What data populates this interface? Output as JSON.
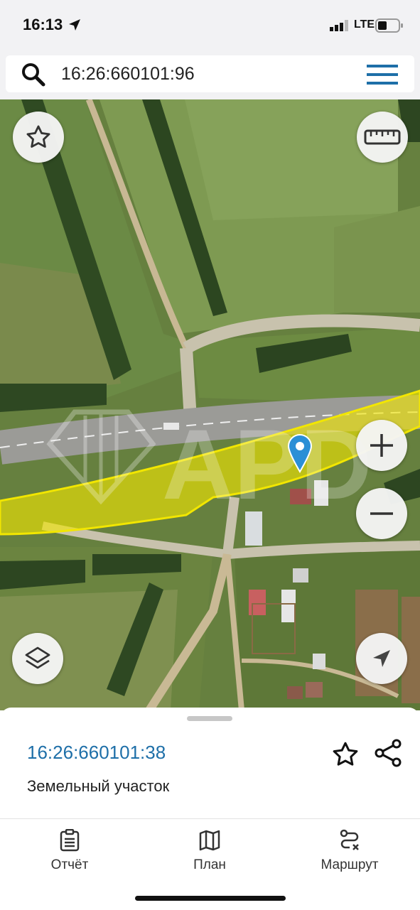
{
  "status_bar": {
    "time": "16:13",
    "network": "LTE"
  },
  "search": {
    "query": "16:26:660101:96"
  },
  "map": {
    "buttons": [
      "star-icon",
      "ruler-icon",
      "zoom-in-icon",
      "zoom-out-icon",
      "layers-icon",
      "location-arrow-icon"
    ],
    "watermark": "APD",
    "parcel_outline_color": "#f2e600",
    "pin_color": "#2b8fd6"
  },
  "bottom_sheet": {
    "cadastral_number": "16:26:660101:38",
    "property_type": "Земельный участок"
  },
  "tab_bar": {
    "tabs": [
      {
        "label": "Отчёт",
        "icon": "report-icon"
      },
      {
        "label": "План",
        "icon": "map-icon"
      },
      {
        "label": "Маршрут",
        "icon": "route-icon"
      }
    ]
  }
}
